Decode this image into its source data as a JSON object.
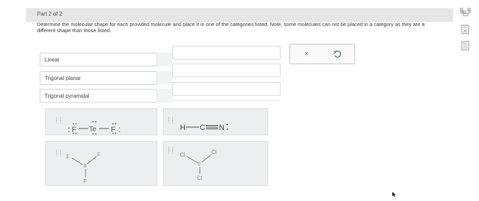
{
  "part_label": "Part 2 of 2",
  "instructions": "Determine the molecular shape for each provided molecule and place it in one of the categories listed. Note, some molecules can not be placed in a category as they are a different shape than those listed.",
  "categories": [
    {
      "label": "Linear"
    },
    {
      "label": "Trigonal planar"
    },
    {
      "label": "Trigonal pyramidal"
    }
  ],
  "actions": {
    "clear_glyph": "×"
  },
  "molecules": {
    "tef2": {
      "left_atom": "F",
      "center_atom": "Te",
      "right_atom": "F"
    },
    "hcn": {
      "h": "H",
      "c": "C",
      "n": "N"
    },
    "bf3": {
      "center": "B",
      "top_left": "F",
      "top_right": "F",
      "bottom": "F"
    },
    "bcl3": {
      "center": "B",
      "top_left": "Cl",
      "top_right": "Cl",
      "bottom": "Cl"
    }
  },
  "sidebar": {
    "icons": [
      "periodic-table-icon",
      "calculator-icon",
      "notes-icon"
    ]
  }
}
